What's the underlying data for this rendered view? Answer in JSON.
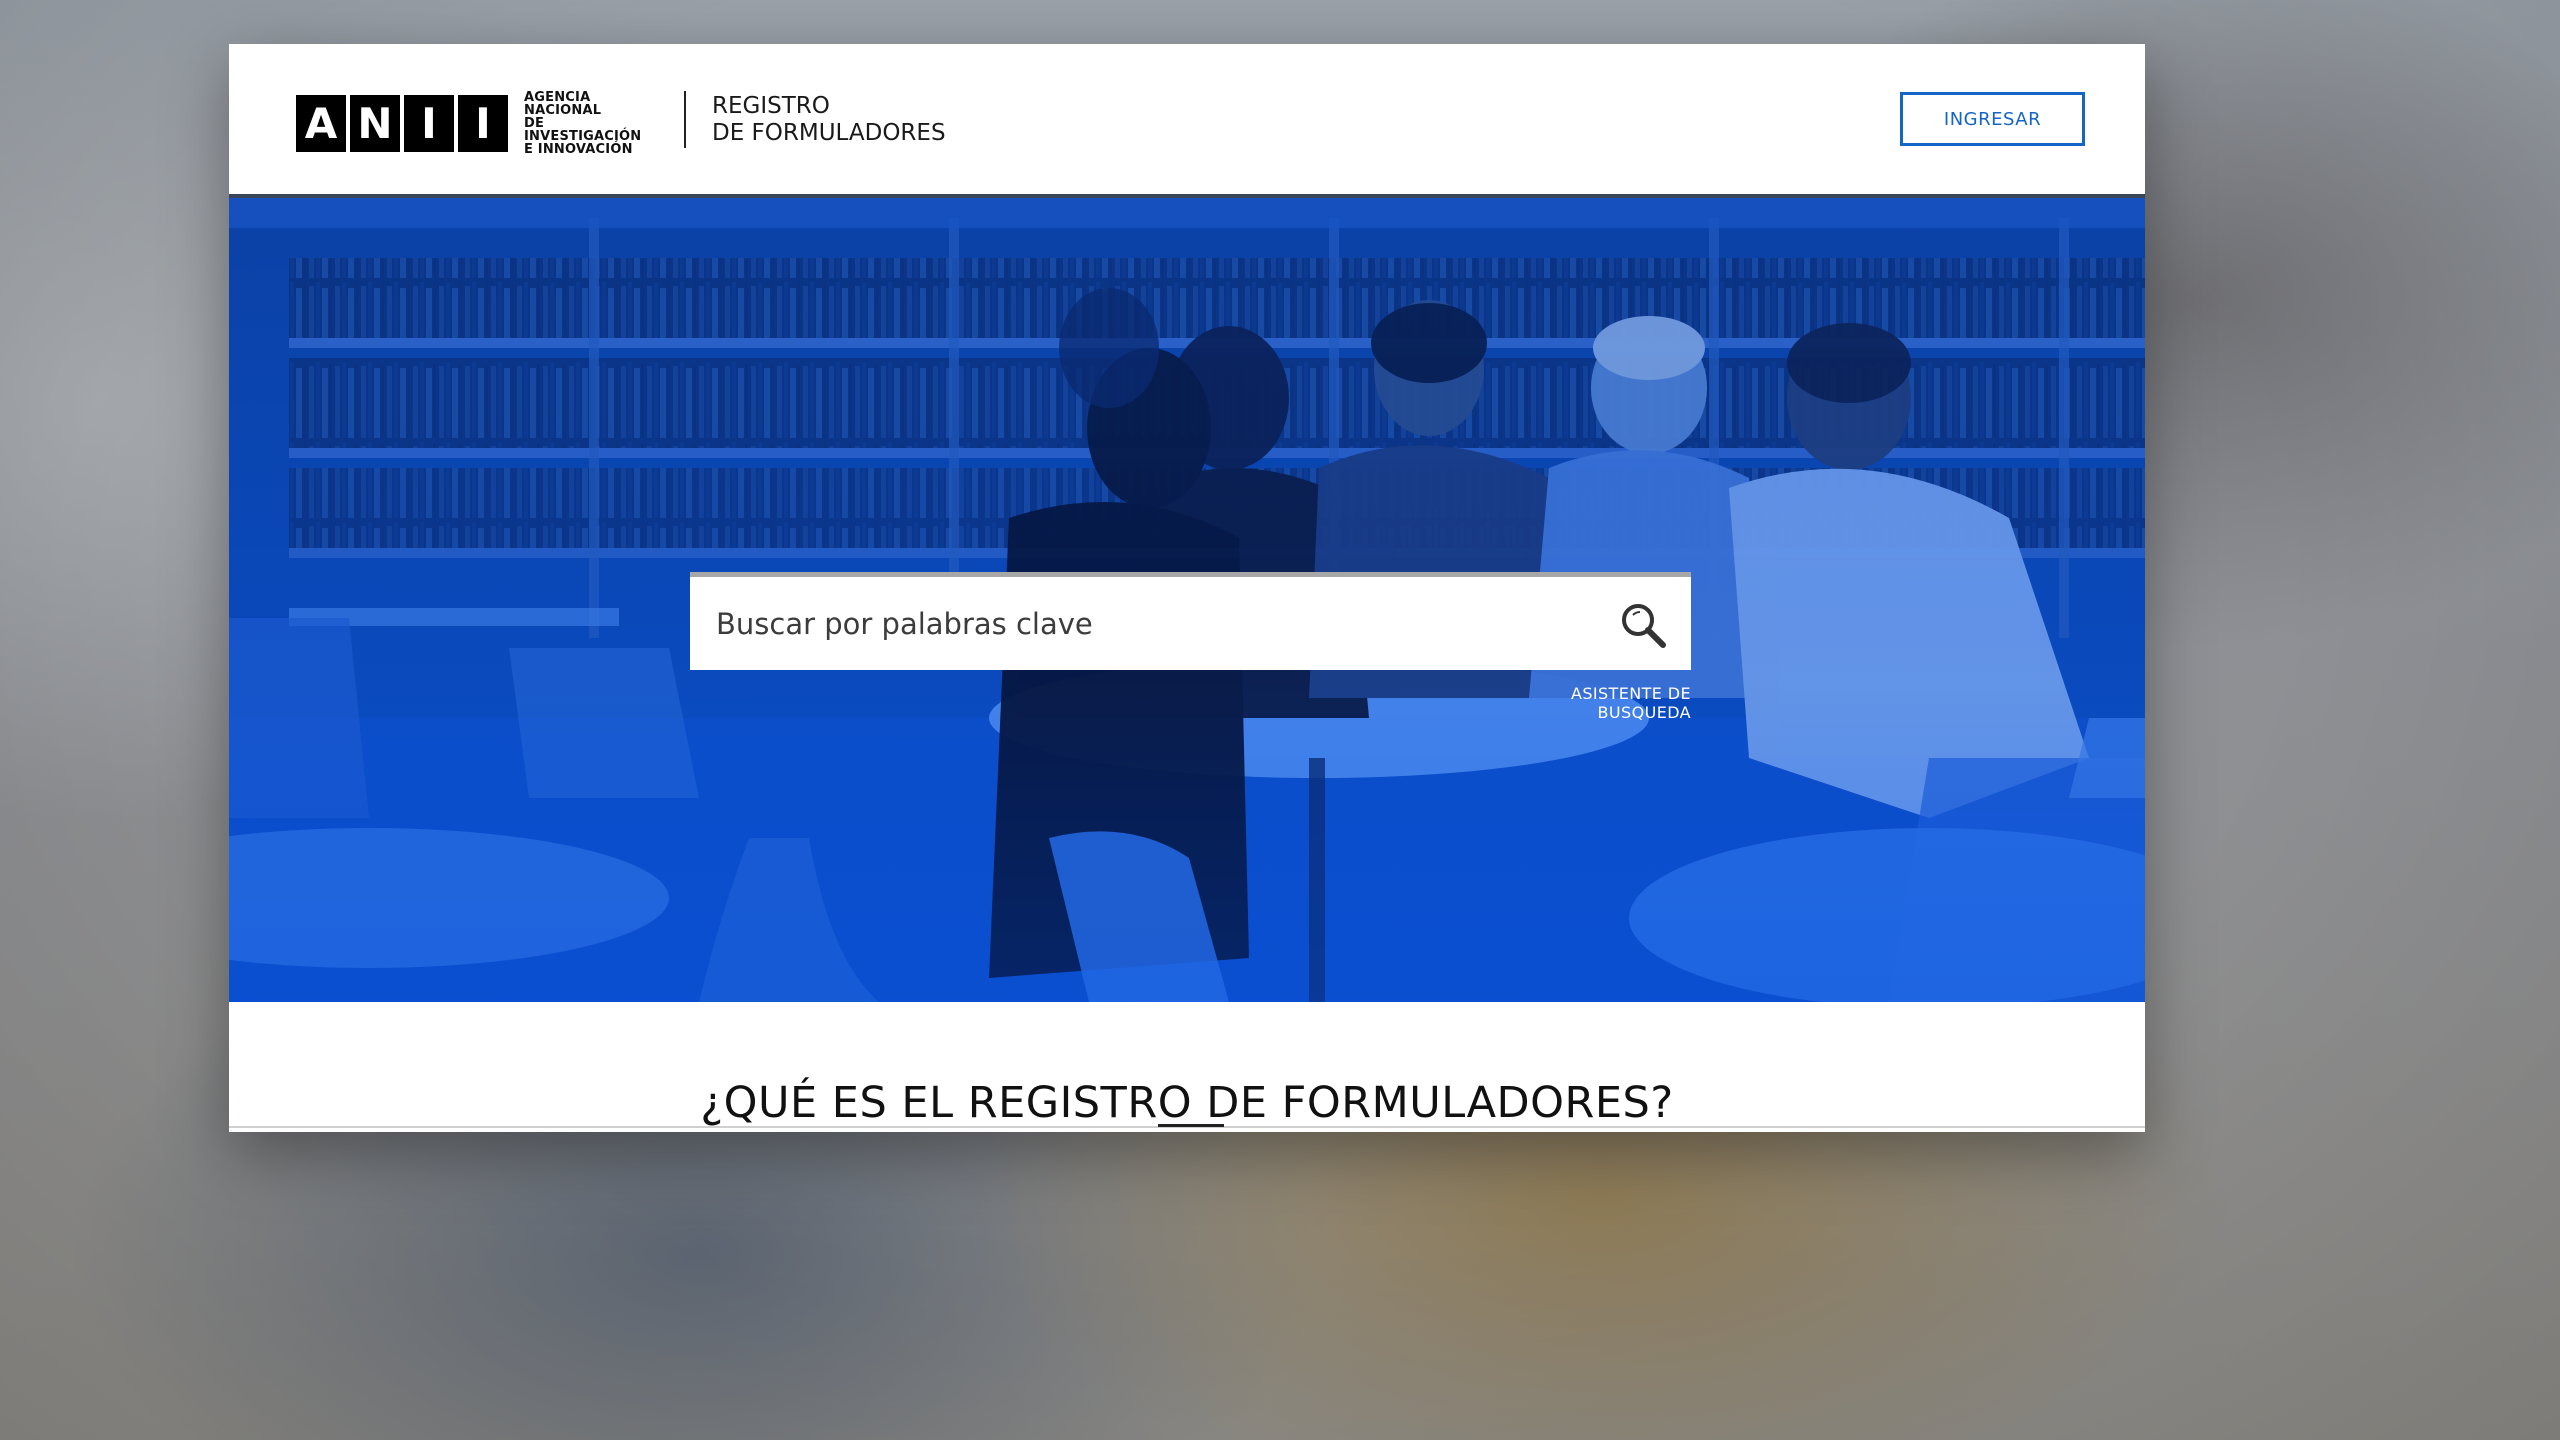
{
  "header": {
    "logo_letters": [
      "A",
      "N",
      "I",
      "I"
    ],
    "agency_lines": [
      "AGENCIA NACIONAL",
      "DE INVESTIGACIÓN",
      "E INNOVACIÓN"
    ],
    "title_lines": [
      "REGISTRO",
      "DE FORMULADORES"
    ],
    "login_label": "INGRESAR"
  },
  "hero": {
    "search_placeholder": "Buscar por palabras clave",
    "search_icon": "magnifier-icon",
    "assistant_label": "ASISTENTE DE BUSQUEDA"
  },
  "section": {
    "title": "¿QUÉ ES EL REGISTRO DE FORMULADORES?"
  },
  "colors": {
    "accent": "#1565c8",
    "hero_blue": "#0a4fc7"
  }
}
